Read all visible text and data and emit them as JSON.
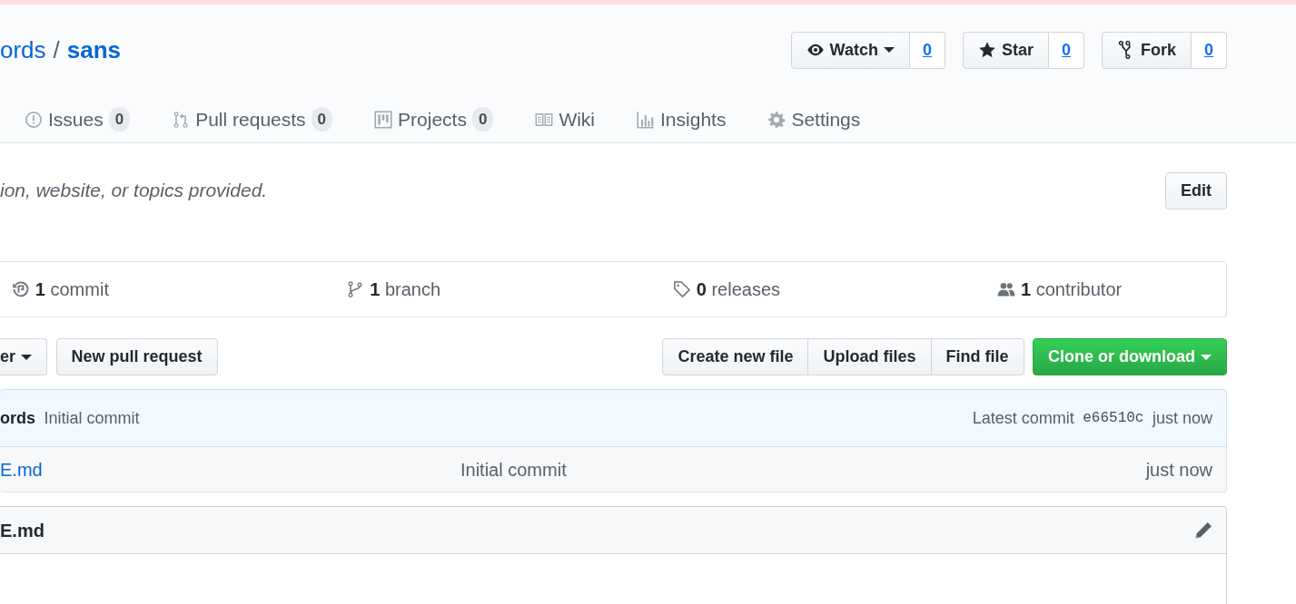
{
  "repo": {
    "owner": "ords",
    "separator": "/",
    "name": "sans"
  },
  "actions": [
    {
      "label": "Watch",
      "dropdown": true,
      "count": "0"
    },
    {
      "label": "Star",
      "dropdown": false,
      "count": "0"
    },
    {
      "label": "Fork",
      "dropdown": false,
      "count": "0"
    }
  ],
  "tabs": [
    {
      "label": "Issues",
      "counter": "0",
      "selected": false
    },
    {
      "label": "Pull requests",
      "counter": "0",
      "selected": false
    },
    {
      "label": "Projects",
      "counter": "0",
      "selected": false
    },
    {
      "label": "Wiki",
      "selected": false
    },
    {
      "label": "Insights",
      "selected": false
    },
    {
      "label": "Settings",
      "selected": false
    }
  ],
  "description": {
    "text": "ion, website, or topics provided.",
    "edit_button": "Edit"
  },
  "summary": [
    {
      "count": "1",
      "label": "commit"
    },
    {
      "count": "1",
      "label": "branch"
    },
    {
      "count": "0",
      "label": "releases"
    },
    {
      "count": "1",
      "label": "contributor"
    }
  ],
  "branch_button": {
    "label": "er",
    "dropdown": true
  },
  "new_pr_button": "New pull request",
  "file_buttons": [
    "Create new file",
    "Upload files",
    "Find file"
  ],
  "clone_button": {
    "label": "Clone or download",
    "dropdown": true
  },
  "latest_commit": {
    "author": "ords",
    "message": "Initial commit",
    "prefix": "Latest commit",
    "sha": "e66510c",
    "time": "just now"
  },
  "files": [
    {
      "name": "E.md",
      "message": "Initial commit",
      "age": "just now"
    }
  ],
  "readme": {
    "title": "E.md"
  }
}
